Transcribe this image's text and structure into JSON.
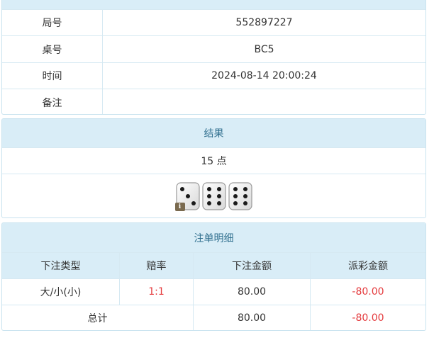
{
  "info": {
    "rows": [
      {
        "label": "局号",
        "value": "552897227"
      },
      {
        "label": "桌号",
        "value": "BC5"
      },
      {
        "label": "时间",
        "value": "2024-08-14 20:00:24"
      },
      {
        "label": "备注",
        "value": ""
      }
    ]
  },
  "result": {
    "title": "结果",
    "points": "15 点",
    "dice": [
      3,
      6,
      6
    ],
    "info_badge": "i"
  },
  "bets": {
    "title": "注单明细",
    "headers": [
      "下注类型",
      "赔率",
      "下注金额",
      "派彩金额"
    ],
    "rows": [
      {
        "type": "大/小(小)",
        "odds": "1:1",
        "amount": "80.00",
        "payout": "-80.00"
      }
    ],
    "total": {
      "label": "总计",
      "amount": "80.00",
      "payout": "-80.00"
    }
  },
  "colors": {
    "header_bg": "#d9edf7",
    "header_text": "#31708f",
    "border": "#d6e9f2",
    "negative": "#e4393c"
  }
}
